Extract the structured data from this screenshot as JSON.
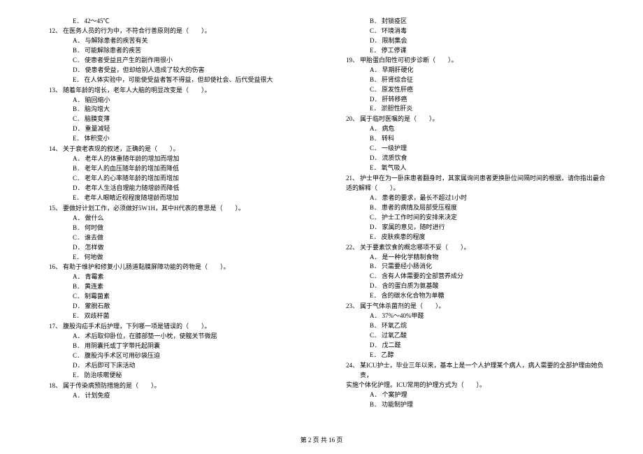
{
  "footer": "第 2 页 共 16 页",
  "left_first_opt": {
    "label": "E．",
    "text": "42～45℃"
  },
  "leftQuestions": [
    {
      "num": "12、",
      "stem": "在医务人员的行为中，不符合行善原则的是（　　）。",
      "opts": [
        {
          "label": "A．",
          "text": "与解除患者的疾苦有关"
        },
        {
          "label": "B．",
          "text": "可能解除患者的疾苦"
        },
        {
          "label": "C．",
          "text": "使患者受益且产生的副作用很小"
        },
        {
          "label": "D．",
          "text": "使患者受益，但却给别人造成了较大的伤害"
        },
        {
          "label": "E．",
          "text": "在人体实验中，可能使受益者暂不得益，但却使社会、后代受益很大"
        }
      ]
    },
    {
      "num": "13、",
      "stem": "随着年龄的增长，老年人大脑的明显改变是（　　）。",
      "opts": [
        {
          "label": "A．",
          "text": "脑回缩小"
        },
        {
          "label": "B．",
          "text": "脑沟增大"
        },
        {
          "label": "C．",
          "text": "脑膜变薄"
        },
        {
          "label": "D．",
          "text": "重量减轻"
        },
        {
          "label": "E．",
          "text": "体积变小"
        }
      ]
    },
    {
      "num": "14、",
      "stem": "关于衰老表现的叙述，正确的是（　　）。",
      "opts": [
        {
          "label": "A．",
          "text": "老年人的体重随年龄的增加而增加"
        },
        {
          "label": "B．",
          "text": "老年人的血压随年龄的增加而降低"
        },
        {
          "label": "C．",
          "text": "老年人的心率随年龄的增加而增加"
        },
        {
          "label": "D．",
          "text": "老年人生活自理能力随增龄而降低"
        },
        {
          "label": "E．",
          "text": "老年人眼睛近视程度随增龄而增加"
        }
      ]
    },
    {
      "num": "15、",
      "stem": "要做好计划工作，必须做好5W1H，其中H代表的意思是（　　）。",
      "opts": [
        {
          "label": "A．",
          "text": "做什么"
        },
        {
          "label": "B．",
          "text": "何时做"
        },
        {
          "label": "C．",
          "text": "谁去做"
        },
        {
          "label": "D．",
          "text": "怎样做"
        },
        {
          "label": "E．",
          "text": "何地做"
        }
      ]
    },
    {
      "num": "16、",
      "stem": "有助于维护和修复小儿肠道黏膜屏障功能的药物是（　　）。",
      "opts": [
        {
          "label": "A．",
          "text": "青霉素"
        },
        {
          "label": "B．",
          "text": "黄连素"
        },
        {
          "label": "C．",
          "text": "制霉菌素"
        },
        {
          "label": "D．",
          "text": "蒙脱石散"
        },
        {
          "label": "E．",
          "text": "双歧杆菌"
        }
      ]
    },
    {
      "num": "17、",
      "stem": "腹股沟疝手术后护理，下列哪一项是错误的（　　）。",
      "opts": [
        {
          "label": "A．",
          "text": "术后取仰卧位，在膝部垫一小枕，使髋关节微屈"
        },
        {
          "label": "B．",
          "text": "用阴囊托或丁字带托起阴囊"
        },
        {
          "label": "C．",
          "text": "腹股沟手术区可用砂袋压迫"
        },
        {
          "label": "D．",
          "text": "术后即可下床活动"
        },
        {
          "label": "E．",
          "text": "防治咳嗽便秘"
        }
      ]
    },
    {
      "num": "18、",
      "stem": "属于传染病预防措施的是（　　）。",
      "opts": [
        {
          "label": "A．",
          "text": "计划免疫"
        }
      ]
    }
  ],
  "right_first_opts": [
    {
      "label": "B．",
      "text": "封锁疫区"
    },
    {
      "label": "C．",
      "text": "环境消毒"
    },
    {
      "label": "D．",
      "text": "限制集会"
    },
    {
      "label": "E．",
      "text": "停工停课"
    }
  ],
  "rightQuestions": [
    {
      "num": "19、",
      "stem": "甲胎蛋白阳性可初步诊断（　　）。",
      "opts": [
        {
          "label": "A．",
          "text": "早期肝硬化"
        },
        {
          "label": "B．",
          "text": "肝肾综合征"
        },
        {
          "label": "C．",
          "text": "原发性肝癌"
        },
        {
          "label": "D．",
          "text": "肝转移癌"
        },
        {
          "label": "E．",
          "text": "淤胆性肝炎"
        }
      ]
    },
    {
      "num": "20、",
      "stem": "属于临时医嘱的是（　　）。",
      "opts": [
        {
          "label": "A．",
          "text": "病危"
        },
        {
          "label": "B．",
          "text": "转科"
        },
        {
          "label": "C．",
          "text": "一级护理"
        },
        {
          "label": "D．",
          "text": "流质饮食"
        },
        {
          "label": "E．",
          "text": "氧气吸人"
        }
      ]
    },
    {
      "num": "21、",
      "stem": "护士甲在为一卧床患者翻身时，其家属询问患者更换卧位间隔时间的根据，请你指出最合",
      "stem_cont": "适的解释（　　）。",
      "opts": [
        {
          "label": "A．",
          "text": "患者的要求，最长不超过1小时"
        },
        {
          "label": "B．",
          "text": "患者的病情及局部受压程度"
        },
        {
          "label": "C．",
          "text": "护士工作时间的安排来决定"
        },
        {
          "label": "D．",
          "text": "家属的意见，随时进行"
        },
        {
          "label": "E．",
          "text": "皮肤疾患的程度"
        }
      ]
    },
    {
      "num": "22、",
      "stem": "关于要素饮食的概念哪项不妥（　　）。",
      "opts": [
        {
          "label": "A．",
          "text": "是一种化学精制食物"
        },
        {
          "label": "B．",
          "text": "只需要经小肠消化"
        },
        {
          "label": "C．",
          "text": "含有人体需要的全部营养成分"
        },
        {
          "label": "D．",
          "text": "含的蛋白质为氨基酸"
        },
        {
          "label": "E．",
          "text": "含的碳水化合物为单糖"
        }
      ]
    },
    {
      "num": "23、",
      "stem": "属于气体杀菌剂的是（　　）。",
      "opts": [
        {
          "label": "A．",
          "text": "37%～40%甲醛"
        },
        {
          "label": "B．",
          "text": "环氧乙烷"
        },
        {
          "label": "C．",
          "text": "过氧乙酸"
        },
        {
          "label": "D．",
          "text": "戊二醛"
        },
        {
          "label": "E．",
          "text": "乙醇"
        }
      ]
    },
    {
      "num": "24、",
      "stem": "某ICU护士，毕业三年以来，基本上是一个人护理某个病人，病人需要的全部护理由她负责，",
      "stem_cont": "实施个体化护理。ICU常用的护理方式为（　　）。",
      "opts": [
        {
          "label": "A．",
          "text": "个案护理"
        },
        {
          "label": "B．",
          "text": "功能制护理"
        }
      ]
    }
  ]
}
